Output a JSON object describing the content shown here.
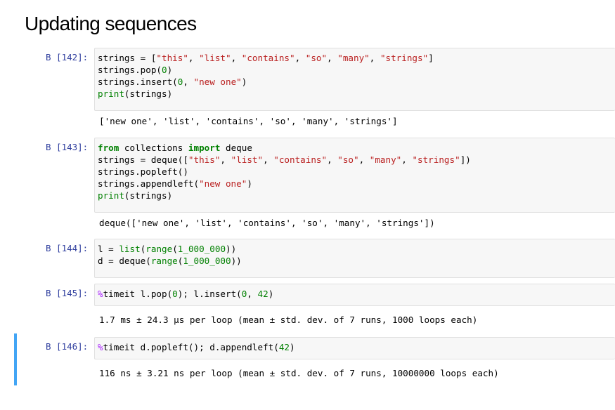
{
  "page": {
    "title": "Updating sequences"
  },
  "cells": [
    {
      "prompt": "В [142]:",
      "code": [
        [
          [
            "strings = [",
            ""
          ],
          [
            "\"this\"",
            "st"
          ],
          [
            ", ",
            ""
          ],
          [
            "\"list\"",
            "st"
          ],
          [
            ", ",
            ""
          ],
          [
            "\"contains\"",
            "st"
          ],
          [
            ", ",
            ""
          ],
          [
            "\"so\"",
            "st"
          ],
          [
            ", ",
            ""
          ],
          [
            "\"many\"",
            "st"
          ],
          [
            ", ",
            ""
          ],
          [
            "\"strings\"",
            "st"
          ],
          [
            "]",
            ""
          ]
        ],
        [
          [
            "strings.pop(",
            ""
          ],
          [
            "0",
            "nm"
          ],
          [
            ")",
            ""
          ]
        ],
        [
          [
            "strings.insert(",
            ""
          ],
          [
            "0",
            "nm"
          ],
          [
            ", ",
            ""
          ],
          [
            "\"new one\"",
            "st"
          ],
          [
            ")",
            ""
          ]
        ],
        [
          [
            "print",
            "bi"
          ],
          [
            "(strings)",
            ""
          ]
        ]
      ],
      "output": "['new one', 'list', 'contains', 'so', 'many', 'strings']"
    },
    {
      "prompt": "В [143]:",
      "code": [
        [
          [
            "from",
            "kw"
          ],
          [
            " collections ",
            ""
          ],
          [
            "import",
            "kw"
          ],
          [
            " deque",
            ""
          ]
        ],
        [
          [
            "strings = deque([",
            ""
          ],
          [
            "\"this\"",
            "st"
          ],
          [
            ", ",
            ""
          ],
          [
            "\"list\"",
            "st"
          ],
          [
            ", ",
            ""
          ],
          [
            "\"contains\"",
            "st"
          ],
          [
            ", ",
            ""
          ],
          [
            "\"so\"",
            "st"
          ],
          [
            ", ",
            ""
          ],
          [
            "\"many\"",
            "st"
          ],
          [
            ", ",
            ""
          ],
          [
            "\"strings\"",
            "st"
          ],
          [
            "])",
            ""
          ]
        ],
        [
          [
            "strings.popleft()",
            ""
          ]
        ],
        [
          [
            "strings.appendleft(",
            ""
          ],
          [
            "\"new one\"",
            "st"
          ],
          [
            ")",
            ""
          ]
        ],
        [
          [
            "print",
            "bi"
          ],
          [
            "(strings)",
            ""
          ]
        ]
      ],
      "output": "deque(['new one', 'list', 'contains', 'so', 'many', 'strings'])"
    },
    {
      "prompt": "В [144]:",
      "code": [
        [
          [
            "l = ",
            ""
          ],
          [
            "list",
            "bi"
          ],
          [
            "(",
            ""
          ],
          [
            "range",
            "bi"
          ],
          [
            "(",
            ""
          ],
          [
            "1_000_000",
            "nm"
          ],
          [
            "))",
            ""
          ]
        ],
        [
          [
            "d = deque(",
            ""
          ],
          [
            "range",
            "bi"
          ],
          [
            "(",
            ""
          ],
          [
            "1_000_000",
            "nm"
          ],
          [
            "))",
            ""
          ]
        ]
      ],
      "output": ""
    },
    {
      "prompt": "В [145]:",
      "code": [
        [
          [
            "%",
            "mg"
          ],
          [
            "timeit l.pop(",
            ""
          ],
          [
            "0",
            "nm"
          ],
          [
            "); l.insert(",
            ""
          ],
          [
            "0",
            "nm"
          ],
          [
            ", ",
            ""
          ],
          [
            "42",
            "nm"
          ],
          [
            ")",
            ""
          ]
        ]
      ],
      "output": "1.7 ms ± 24.3 µs per loop (mean ± std. dev. of 7 runs, 1000 loops each)"
    },
    {
      "prompt": "В [146]:",
      "code": [
        [
          [
            "%",
            "mg"
          ],
          [
            "timeit d.popleft(); d.appendleft(",
            ""
          ],
          [
            "42",
            "nm"
          ],
          [
            ")",
            ""
          ]
        ]
      ],
      "output": "116 ns ± 3.21 ns per loop (mean ± std. dev. of 7 runs, 10000000 loops each)"
    }
  ],
  "colors": {
    "prompt": "#303f9f",
    "string": "#ba2121",
    "keyword": "#008000",
    "number": "#008000",
    "magic": "#aa22ff",
    "selected_border": "#42a5f5"
  }
}
